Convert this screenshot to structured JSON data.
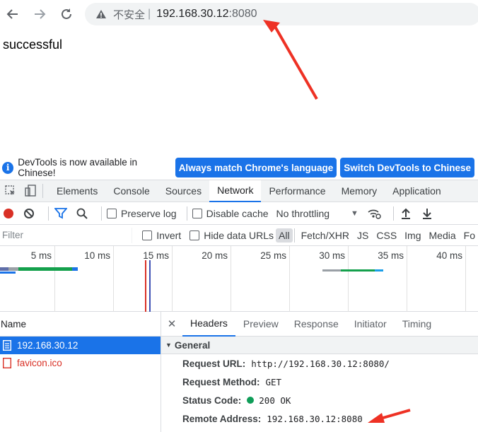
{
  "browser": {
    "security_label": "不安全",
    "separator": "|",
    "url_host": "192.168.30.12",
    "url_port": ":8080",
    "icons": [
      "back-arrow-icon",
      "forward-arrow-icon",
      "reload-icon",
      "warning-icon"
    ]
  },
  "page": {
    "body_text": "successful"
  },
  "devtools": {
    "infobar": {
      "message": "DevTools is now available in Chinese!",
      "btn_match": "Always match Chrome's language",
      "btn_switch": "Switch DevTools to Chinese"
    },
    "tabs": [
      "Elements",
      "Console",
      "Sources",
      "Network",
      "Performance",
      "Memory",
      "Application"
    ],
    "active_tab": "Network",
    "toolbar": {
      "preserve_log": "Preserve log",
      "disable_cache": "Disable cache",
      "throttling": "No throttling"
    },
    "filter": {
      "placeholder": "Filter",
      "invert": "Invert",
      "hide_data_urls": "Hide data URLs",
      "types": [
        "All",
        "Fetch/XHR",
        "JS",
        "CSS",
        "Img",
        "Media",
        "Fo"
      ]
    },
    "timeline_ticks": [
      "5 ms",
      "10 ms",
      "15 ms",
      "20 ms",
      "25 ms",
      "30 ms",
      "35 ms",
      "40 ms"
    ],
    "requests": {
      "header": "Name",
      "rows": [
        {
          "name": "192.168.30.12"
        },
        {
          "name": "favicon.ico"
        }
      ]
    },
    "details": {
      "tabs": [
        "Headers",
        "Preview",
        "Response",
        "Initiator",
        "Timing"
      ],
      "section": "General",
      "request_url_label": "Request URL:",
      "request_url": "http://192.168.30.12:8080/",
      "request_method_label": "Request Method:",
      "request_method": "GET",
      "status_code_label": "Status Code:",
      "status_code": "200 OK",
      "remote_address_label": "Remote Address:",
      "remote_address": "192.168.30.12:8080"
    }
  },
  "colors": {
    "accent": "#1a73e8",
    "annotation_arrow": "#ee3124",
    "status_ok": "#0f9d58"
  }
}
